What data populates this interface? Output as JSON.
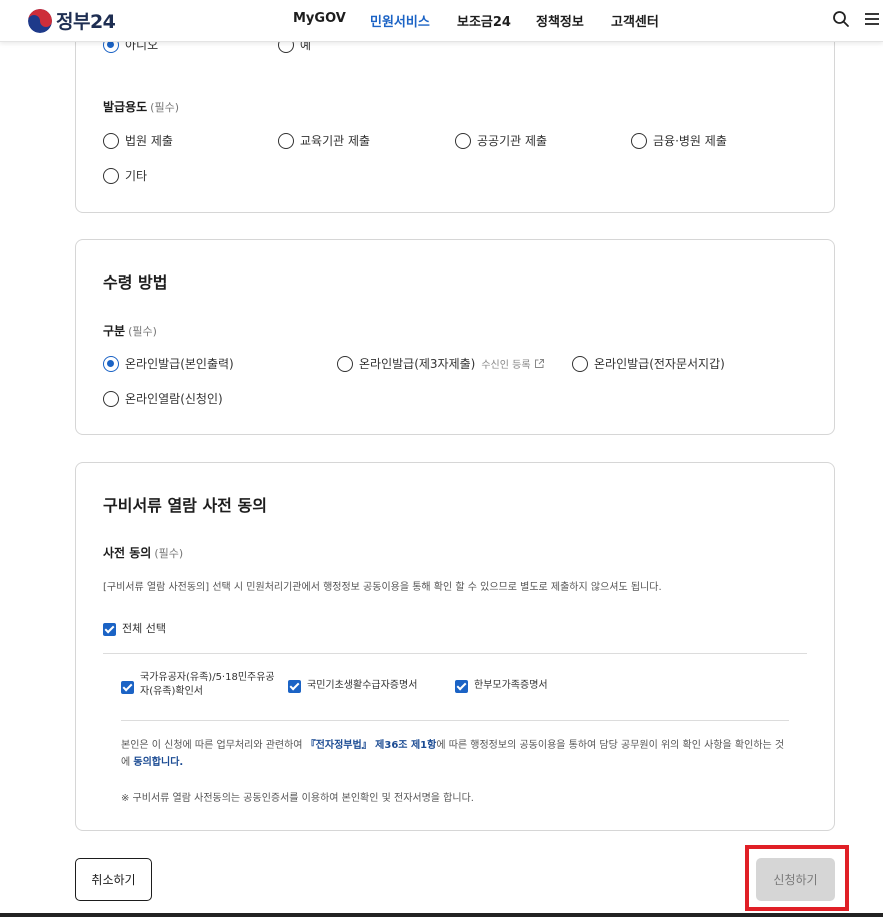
{
  "header": {
    "logo_text": "정부24",
    "nav": [
      "MyGOV",
      "민원서비스",
      "보조금24",
      "정책정보",
      "고객센터"
    ],
    "active_nav": "민원서비스",
    "icons": [
      "search-icon",
      "menu-icon"
    ]
  },
  "section1": {
    "top_radios": [
      "아니오",
      "예"
    ],
    "purpose_label": "발급용도",
    "required_text": "(필수)",
    "purpose_options": [
      "법원 제출",
      "교육기관 제출",
      "공공기관 제출",
      "금융·병원 제출",
      "기타"
    ]
  },
  "section2": {
    "title": "수령 방법",
    "field_label": "구분",
    "required_text": "(필수)",
    "options": [
      "온라인발급(본인출력)",
      "온라인발급(제3자제출)",
      "온라인발급(전자문서지갑)",
      "온라인열람(신청인)"
    ],
    "recipient_link": "수신인 등록",
    "selected": "온라인발급(본인출력)"
  },
  "section3": {
    "title": "구비서류 열람 사전 동의",
    "field_label": "사전 동의",
    "required_text": "(필수)",
    "description": "[구비서류 열람 사전동의] 선택 시 민원처리기관에서 행정정보 공동이용을 통해 확인 할 수 있으므로 별도로 제출하지 않으셔도 됩니다.",
    "select_all": "전체 선택",
    "documents": [
      "국가유공자(유족)/5·18민주유공자(유족)확인서",
      "국민기초생활수급자증명서",
      "한부모가족증명서"
    ],
    "consent_prefix": "본인은 이 신청에 따른 업무처리와 관련하여 ",
    "consent_law": "『전자정부법』 제36조 제1항",
    "consent_middle": "에 따른 행정정보의 공동이용을 통하여 담당 공무원이 위의 확인 사항을 확인하는 것에 ",
    "consent_agree": "동의합니다.",
    "note": "※ 구비서류 열람 사전동의는 공동인증서를 이용하여 본인확인 및 전자서명을 합니다."
  },
  "buttons": {
    "cancel": "취소하기",
    "apply": "신청하기"
  },
  "colors": {
    "accent": "#1b63c5",
    "highlight": "#e01f26",
    "disabled_button": "#d6d6d6"
  }
}
